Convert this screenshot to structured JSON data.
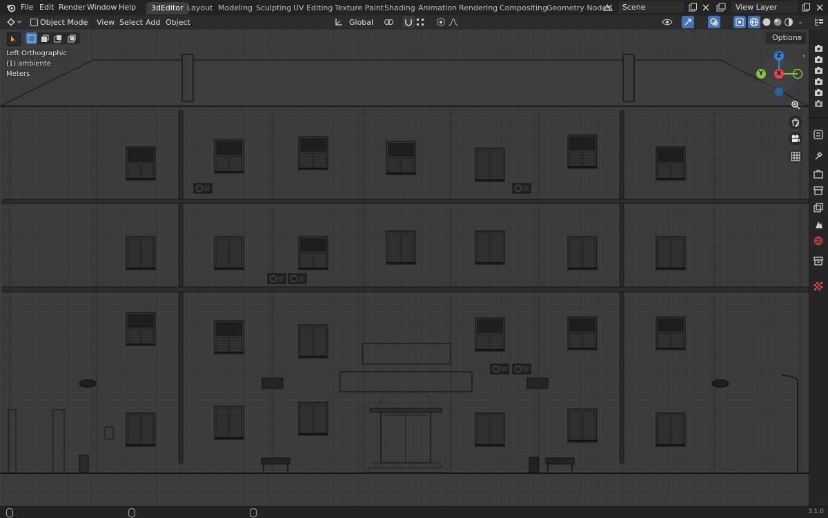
{
  "menubar": {
    "items": [
      "File",
      "Edit",
      "Render",
      "Window",
      "Help"
    ],
    "workspaces": [
      "3dEditor",
      "Layout",
      "Modeling",
      "Sculpting",
      "UV Editing",
      "Texture Paint",
      "Shading",
      "Animation",
      "Rendering",
      "Compositing",
      "Geometry Nodes"
    ],
    "active_workspace": "3dEditor",
    "scene": "Scene",
    "view_layer": "View Layer"
  },
  "header": {
    "mode": "Object Mode",
    "menus": [
      "View",
      "Select",
      "Add",
      "Object"
    ],
    "transform_orientation": "Global",
    "options_label": "Options"
  },
  "viewport": {
    "view_name": "Left Orthographic",
    "collection_info": "(1) ambiente",
    "units": "Meters",
    "gizmo_axes": {
      "z": "Z",
      "y": "Y",
      "x": "X"
    }
  },
  "status": {
    "version": "3.1.0"
  },
  "colors": {
    "background": "#3b3b3b",
    "grid": "#4a4a4a",
    "active_tab": "#3d3d3d",
    "axis_x": "#e5434f",
    "axis_y": "#85c53e",
    "axis_z": "#2f7fd6",
    "accent": "#4772b3"
  },
  "icons": [
    "blender-logo",
    "editor-type-icon",
    "object-mode-icon",
    "transform-pivot-icon",
    "snap-icon",
    "proportional-edit-icon",
    "visibility-icon",
    "gizmo-icon",
    "overlay-icon",
    "xray-icon",
    "wireframe-shading-icon",
    "solid-shading-icon",
    "material-shading-icon",
    "rendered-shading-icon",
    "zoom-icon",
    "pan-hand-icon",
    "camera-icon",
    "grid-icon",
    "outliner-icon",
    "properties-icon"
  ]
}
